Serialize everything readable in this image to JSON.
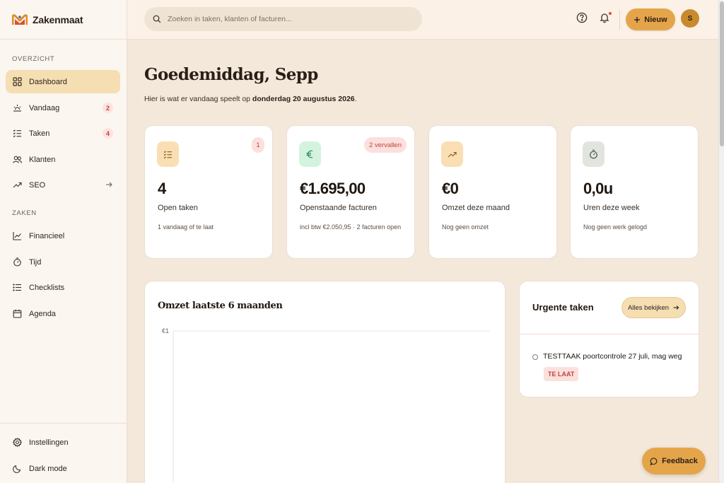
{
  "app": {
    "name": "Zakenmaat"
  },
  "sidebar": {
    "section_overview": "OVERZICHT",
    "section_business": "ZAKEN",
    "items": [
      {
        "label": "Dashboard",
        "icon": "grid-icon",
        "active": true
      },
      {
        "label": "Vandaag",
        "icon": "sunrise-icon",
        "badge": "2"
      },
      {
        "label": "Taken",
        "icon": "checklist-icon",
        "badge": "4"
      },
      {
        "label": "Klanten",
        "icon": "users-icon"
      },
      {
        "label": "SEO",
        "icon": "trend-icon",
        "arrow": true
      },
      {
        "label": "Financieel",
        "icon": "chart-line-icon"
      },
      {
        "label": "Tijd",
        "icon": "stopwatch-icon"
      },
      {
        "label": "Checklists",
        "icon": "list-icon"
      },
      {
        "label": "Agenda",
        "icon": "calendar-icon"
      }
    ],
    "bottom": [
      {
        "label": "Instellingen",
        "icon": "gear-icon"
      },
      {
        "label": "Dark mode",
        "icon": "moon-icon"
      }
    ]
  },
  "topbar": {
    "search_placeholder": "Zoeken in taken, klanten of facturen...",
    "new_label": "Nieuw",
    "avatar_initial": "S"
  },
  "main": {
    "greeting": "Goedemiddag, Sepp",
    "subline_prefix": "Hier is wat er vandaag speelt op",
    "subline_date": "donderdag 20 augustus 2026",
    "subline_suffix": "."
  },
  "stats": [
    {
      "value": "4",
      "label": "Open taken",
      "note": "1 vandaag of te laat",
      "pill": "1",
      "icon": "checklist-icon"
    },
    {
      "value": "€1.695,00",
      "label": "Openstaande facturen",
      "note": "incl btw €2.050,95 · 2 facturen open",
      "pill": "2 vervallen",
      "icon": "euro-icon"
    },
    {
      "value": "€0",
      "label": "Omzet deze maand",
      "note": "Nog geen omzet",
      "icon": "trend-up-icon"
    },
    {
      "value": "0,0u",
      "label": "Uren deze week",
      "note": "Nog geen werk gelogd",
      "icon": "stopwatch-icon"
    }
  ],
  "chart": {
    "title": "Omzet laatste 6 maanden",
    "y_tick_top": "€1"
  },
  "chart_data": {
    "type": "bar",
    "title": "Omzet laatste 6 maanden",
    "y_ticks": [
      "€1"
    ],
    "ylim": [
      0,
      1
    ],
    "grid": true
  },
  "urgent": {
    "title": "Urgente taken",
    "view_all_label": "Alles bekijken",
    "tasks": [
      {
        "text": "TESTTAAK poortcontrole 27 juli, mag weg",
        "badge": "TE LAAT"
      }
    ]
  },
  "feedback_label": "Feedback",
  "colors": {
    "accent": "#e4a54a",
    "accent_soft": "#f5deb2",
    "background": "#f3e8da",
    "danger": "#c2433b",
    "danger_soft": "#fbe0dd"
  }
}
